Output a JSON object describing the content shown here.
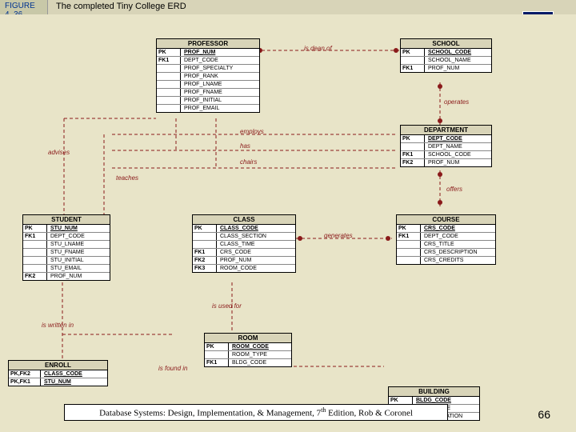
{
  "figure": {
    "label": "FIGURE\n4. 36",
    "title": "The completed Tiny College ERD"
  },
  "chapter": "4",
  "footer": {
    "text": "Database Systems: Design, Implementation, & Management, 7",
    "suffix": " Edition, Rob & Coronel",
    "sup": "th"
  },
  "page": "66",
  "entities": {
    "professor": {
      "title": "PROFESSOR",
      "pk": "PROF_NUM",
      "rows": [
        [
          "FK1",
          "DEPT_CODE"
        ],
        [
          "",
          "PROF_SPECIALTY"
        ],
        [
          "",
          "PROF_RANK"
        ],
        [
          "",
          "PROF_LNAME"
        ],
        [
          "",
          "PROF_FNAME"
        ],
        [
          "",
          "PROF_INITIAL"
        ],
        [
          "",
          "PROF_EMAIL"
        ]
      ]
    },
    "school": {
      "title": "SCHOOL",
      "pk": "SCHOOL_CODE",
      "rows": [
        [
          "",
          "SCHOOL_NAME"
        ],
        [
          "FK1",
          "PROF_NUM"
        ]
      ]
    },
    "department": {
      "title": "DEPARTMENT",
      "pk": "DEPT_CODE",
      "rows": [
        [
          "",
          "DEPT_NAME"
        ],
        [
          "FK1",
          "SCHOOL_CODE"
        ],
        [
          "FK2",
          "PROF_NUM"
        ]
      ]
    },
    "student": {
      "title": "STUDENT",
      "pk": "STU_NUM",
      "rows": [
        [
          "FK1",
          "DEPT_CODE"
        ],
        [
          "",
          "STU_LNAME"
        ],
        [
          "",
          "STU_FNAME"
        ],
        [
          "",
          "STU_INITIAL"
        ],
        [
          "",
          "STU_EMAIL"
        ],
        [
          "FK2",
          "PROF_NUM"
        ]
      ]
    },
    "class": {
      "title": "CLASS",
      "pk": "CLASS_CODE",
      "rows": [
        [
          "",
          "CLASS_SECTION"
        ],
        [
          "",
          "CLASS_TIME"
        ],
        [
          "FK1",
          "CRS_CODE"
        ],
        [
          "FK2",
          "PROF_NUM"
        ],
        [
          "FK3",
          "ROOM_CODE"
        ]
      ]
    },
    "course": {
      "title": "COURSE",
      "pk": "CRS_CODE",
      "rows": [
        [
          "FK1",
          "DEPT_CODE"
        ],
        [
          "",
          "CRS_TITLE"
        ],
        [
          "",
          "CRS_DESCRIPTION"
        ],
        [
          "",
          "CRS_CREDITS"
        ]
      ]
    },
    "enroll": {
      "title": "ENROLL",
      "rows": [
        [
          "PK,FK2",
          "CLASS_CODE"
        ],
        [
          "PK,FK1",
          "STU_NUM"
        ]
      ]
    },
    "room": {
      "title": "ROOM",
      "pk": "ROOM_CODE",
      "rows": [
        [
          "",
          "ROOM_TYPE"
        ],
        [
          "FK1",
          "BLDG_CODE"
        ]
      ]
    },
    "building": {
      "title": "BUILDING",
      "pk": "BLDG_CODE",
      "rows": [
        [
          "",
          "BLDG_NAME"
        ],
        [
          "",
          "BLDG_LOCATION"
        ]
      ]
    }
  },
  "relationships": {
    "is_dean_of": "is dean of",
    "operates": "operates",
    "advises": "advises",
    "has": "has",
    "employs": "employs",
    "chairs": "chairs",
    "teaches": "teaches",
    "offers": "offers",
    "generates": "generates",
    "is_written_in": "is written in",
    "is_used_for": "is used for",
    "is_found_in": "is found in"
  }
}
